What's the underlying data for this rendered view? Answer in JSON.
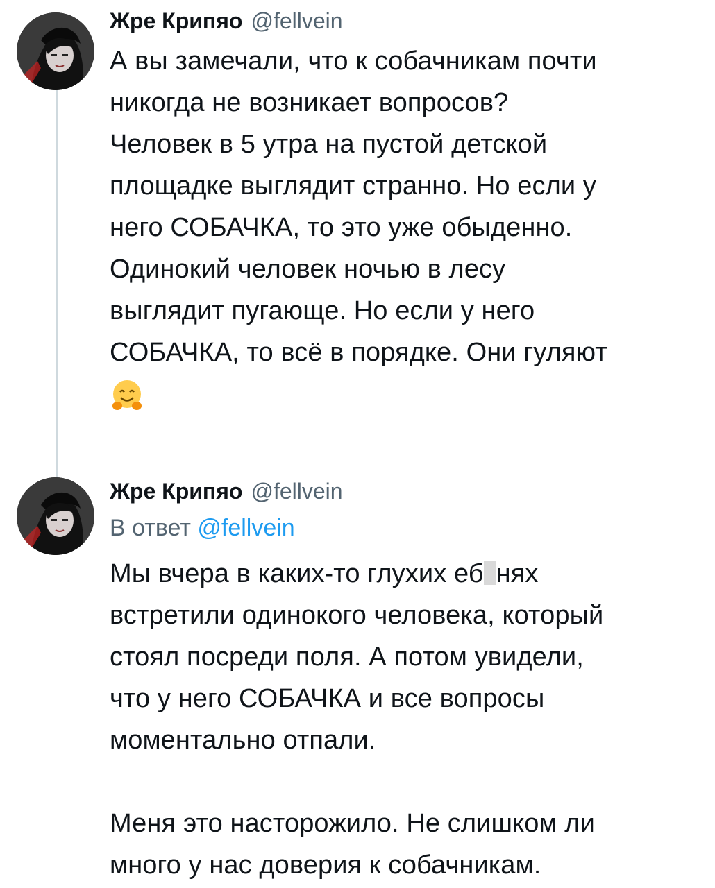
{
  "tweet1": {
    "author_name": "Жре Крипяо",
    "author_handle": "@fellvein",
    "lines": [
      "А вы замечали, что к собачникам почти",
      "никогда не возникает вопросов?",
      "Человек в 5 утра на пустой детской",
      "площадке выглядит странно. Но если у",
      "него СОБАЧКА, то это уже обыденно.",
      "Одинокий человек ночью в лесу",
      "выглядит пугающе. Но если у него",
      "СОБАЧКА, то всё в порядке. Они гуляют"
    ],
    "emoji": "hugging-face-emoji"
  },
  "tweet2": {
    "author_name": "Жре Крипяо",
    "author_handle": "@fellvein",
    "reply_prefix": "В ответ",
    "reply_mention": "@fellvein",
    "line1_start": "Мы вчера в каких-то глухих еб",
    "line1_end": "нях",
    "lines": [
      "встретили одинокого человека, который",
      "стоял посреди поля. А потом увидели,",
      "что у него СОБАЧКА и все вопросы",
      "моментально отпали."
    ],
    "lines2": [
      "Меня это насторожило. Не слишком ли",
      "много у нас доверия к собачникам."
    ]
  }
}
